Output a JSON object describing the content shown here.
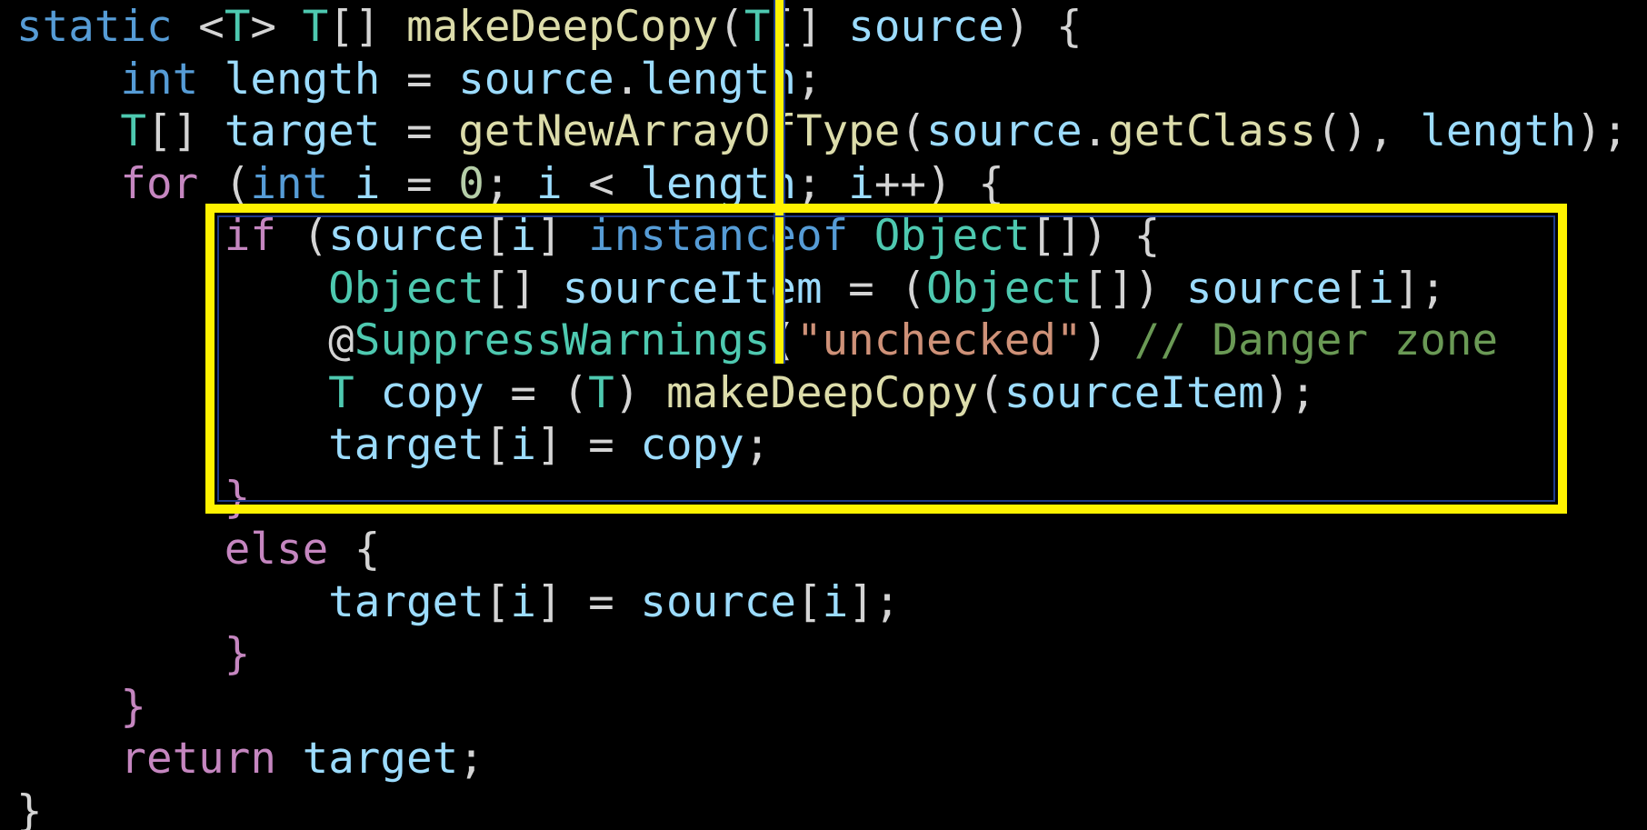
{
  "colors": {
    "background": "#000000",
    "keyword": "#569cd6",
    "control": "#c586c0",
    "type": "#4ec9b0",
    "function": "#dcdcaa",
    "variable": "#9cdcfe",
    "string": "#ce9178",
    "comment": "#6a9955",
    "number": "#b5cea8",
    "punct": "#d4d4d4",
    "highlight": "#fff200"
  },
  "code_lines": [
    [
      {
        "t": "static",
        "c": "keyword"
      },
      {
        "t": " ",
        "c": "punct"
      },
      {
        "t": "<",
        "c": "punct"
      },
      {
        "t": "T",
        "c": "type"
      },
      {
        "t": ">",
        "c": "punct"
      },
      {
        "t": " ",
        "c": "punct"
      },
      {
        "t": "T",
        "c": "type"
      },
      {
        "t": "[] ",
        "c": "punct"
      },
      {
        "t": "makeDeepCopy",
        "c": "function"
      },
      {
        "t": "(",
        "c": "punct"
      },
      {
        "t": "T",
        "c": "type"
      },
      {
        "t": "[] ",
        "c": "punct"
      },
      {
        "t": "source",
        "c": "variable"
      },
      {
        "t": ") {",
        "c": "punct"
      }
    ],
    [
      {
        "t": "    ",
        "c": "punct"
      },
      {
        "t": "int",
        "c": "keyword"
      },
      {
        "t": " ",
        "c": "punct"
      },
      {
        "t": "length",
        "c": "variable"
      },
      {
        "t": " = ",
        "c": "punct"
      },
      {
        "t": "source",
        "c": "variable"
      },
      {
        "t": ".",
        "c": "punct"
      },
      {
        "t": "length",
        "c": "variable"
      },
      {
        "t": ";",
        "c": "punct"
      }
    ],
    [
      {
        "t": "    ",
        "c": "punct"
      },
      {
        "t": "T",
        "c": "type"
      },
      {
        "t": "[] ",
        "c": "punct"
      },
      {
        "t": "target",
        "c": "variable"
      },
      {
        "t": " = ",
        "c": "punct"
      },
      {
        "t": "getNewArrayOfType",
        "c": "function"
      },
      {
        "t": "(",
        "c": "punct"
      },
      {
        "t": "source",
        "c": "variable"
      },
      {
        "t": ".",
        "c": "punct"
      },
      {
        "t": "getClass",
        "c": "function"
      },
      {
        "t": "(), ",
        "c": "punct"
      },
      {
        "t": "length",
        "c": "variable"
      },
      {
        "t": ");",
        "c": "punct"
      }
    ],
    [
      {
        "t": "    ",
        "c": "punct"
      },
      {
        "t": "for",
        "c": "control"
      },
      {
        "t": " (",
        "c": "punct"
      },
      {
        "t": "int",
        "c": "keyword"
      },
      {
        "t": " ",
        "c": "punct"
      },
      {
        "t": "i",
        "c": "variable"
      },
      {
        "t": " = ",
        "c": "punct"
      },
      {
        "t": "0",
        "c": "number"
      },
      {
        "t": "; ",
        "c": "punct"
      },
      {
        "t": "i",
        "c": "variable"
      },
      {
        "t": " < ",
        "c": "punct"
      },
      {
        "t": "length",
        "c": "variable"
      },
      {
        "t": "; ",
        "c": "punct"
      },
      {
        "t": "i",
        "c": "variable"
      },
      {
        "t": "++) {",
        "c": "punct"
      }
    ],
    [
      {
        "t": "        ",
        "c": "punct"
      },
      {
        "t": "if",
        "c": "control"
      },
      {
        "t": " (",
        "c": "punct"
      },
      {
        "t": "source",
        "c": "variable"
      },
      {
        "t": "[",
        "c": "punct"
      },
      {
        "t": "i",
        "c": "variable"
      },
      {
        "t": "] ",
        "c": "punct"
      },
      {
        "t": "instanceof",
        "c": "keyword"
      },
      {
        "t": " ",
        "c": "punct"
      },
      {
        "t": "Object",
        "c": "type"
      },
      {
        "t": "[]) {",
        "c": "punct"
      }
    ],
    [
      {
        "t": "            ",
        "c": "punct"
      },
      {
        "t": "Object",
        "c": "type"
      },
      {
        "t": "[] ",
        "c": "punct"
      },
      {
        "t": "sourceItem",
        "c": "variable"
      },
      {
        "t": " = (",
        "c": "punct"
      },
      {
        "t": "Object",
        "c": "type"
      },
      {
        "t": "[]) ",
        "c": "punct"
      },
      {
        "t": "source",
        "c": "variable"
      },
      {
        "t": "[",
        "c": "punct"
      },
      {
        "t": "i",
        "c": "variable"
      },
      {
        "t": "];",
        "c": "punct"
      }
    ],
    [
      {
        "t": "            ",
        "c": "punct"
      },
      {
        "t": "@",
        "c": "punct"
      },
      {
        "t": "SuppressWarnings",
        "c": "type"
      },
      {
        "t": "(",
        "c": "punct"
      },
      {
        "t": "\"unchecked\"",
        "c": "string"
      },
      {
        "t": ") ",
        "c": "punct"
      },
      {
        "t": "// Danger zone",
        "c": "comment"
      }
    ],
    [
      {
        "t": "            ",
        "c": "punct"
      },
      {
        "t": "T",
        "c": "type"
      },
      {
        "t": " ",
        "c": "punct"
      },
      {
        "t": "copy",
        "c": "variable"
      },
      {
        "t": " = (",
        "c": "punct"
      },
      {
        "t": "T",
        "c": "type"
      },
      {
        "t": ") ",
        "c": "punct"
      },
      {
        "t": "makeDeepCopy",
        "c": "function"
      },
      {
        "t": "(",
        "c": "punct"
      },
      {
        "t": "sourceItem",
        "c": "variable"
      },
      {
        "t": ");",
        "c": "punct"
      }
    ],
    [
      {
        "t": "            ",
        "c": "punct"
      },
      {
        "t": "target",
        "c": "variable"
      },
      {
        "t": "[",
        "c": "punct"
      },
      {
        "t": "i",
        "c": "variable"
      },
      {
        "t": "] = ",
        "c": "punct"
      },
      {
        "t": "copy",
        "c": "variable"
      },
      {
        "t": ";",
        "c": "punct"
      }
    ],
    [
      {
        "t": "        ",
        "c": "punct"
      },
      {
        "t": "}",
        "c": "control"
      }
    ],
    [
      {
        "t": "        ",
        "c": "punct"
      },
      {
        "t": "else",
        "c": "control"
      },
      {
        "t": " {",
        "c": "punct"
      }
    ],
    [
      {
        "t": "            ",
        "c": "punct"
      },
      {
        "t": "target",
        "c": "variable"
      },
      {
        "t": "[",
        "c": "punct"
      },
      {
        "t": "i",
        "c": "variable"
      },
      {
        "t": "] = ",
        "c": "punct"
      },
      {
        "t": "source",
        "c": "variable"
      },
      {
        "t": "[",
        "c": "punct"
      },
      {
        "t": "i",
        "c": "variable"
      },
      {
        "t": "];",
        "c": "punct"
      }
    ],
    [
      {
        "t": "        ",
        "c": "punct"
      },
      {
        "t": "}",
        "c": "control"
      }
    ],
    [
      {
        "t": "    ",
        "c": "punct"
      },
      {
        "t": "}",
        "c": "control"
      }
    ],
    [
      {
        "t": "    ",
        "c": "punct"
      },
      {
        "t": "return",
        "c": "control"
      },
      {
        "t": " ",
        "c": "punct"
      },
      {
        "t": "target",
        "c": "variable"
      },
      {
        "t": ";",
        "c": "punct"
      }
    ],
    [
      {
        "t": "}",
        "c": "punct"
      }
    ]
  ]
}
